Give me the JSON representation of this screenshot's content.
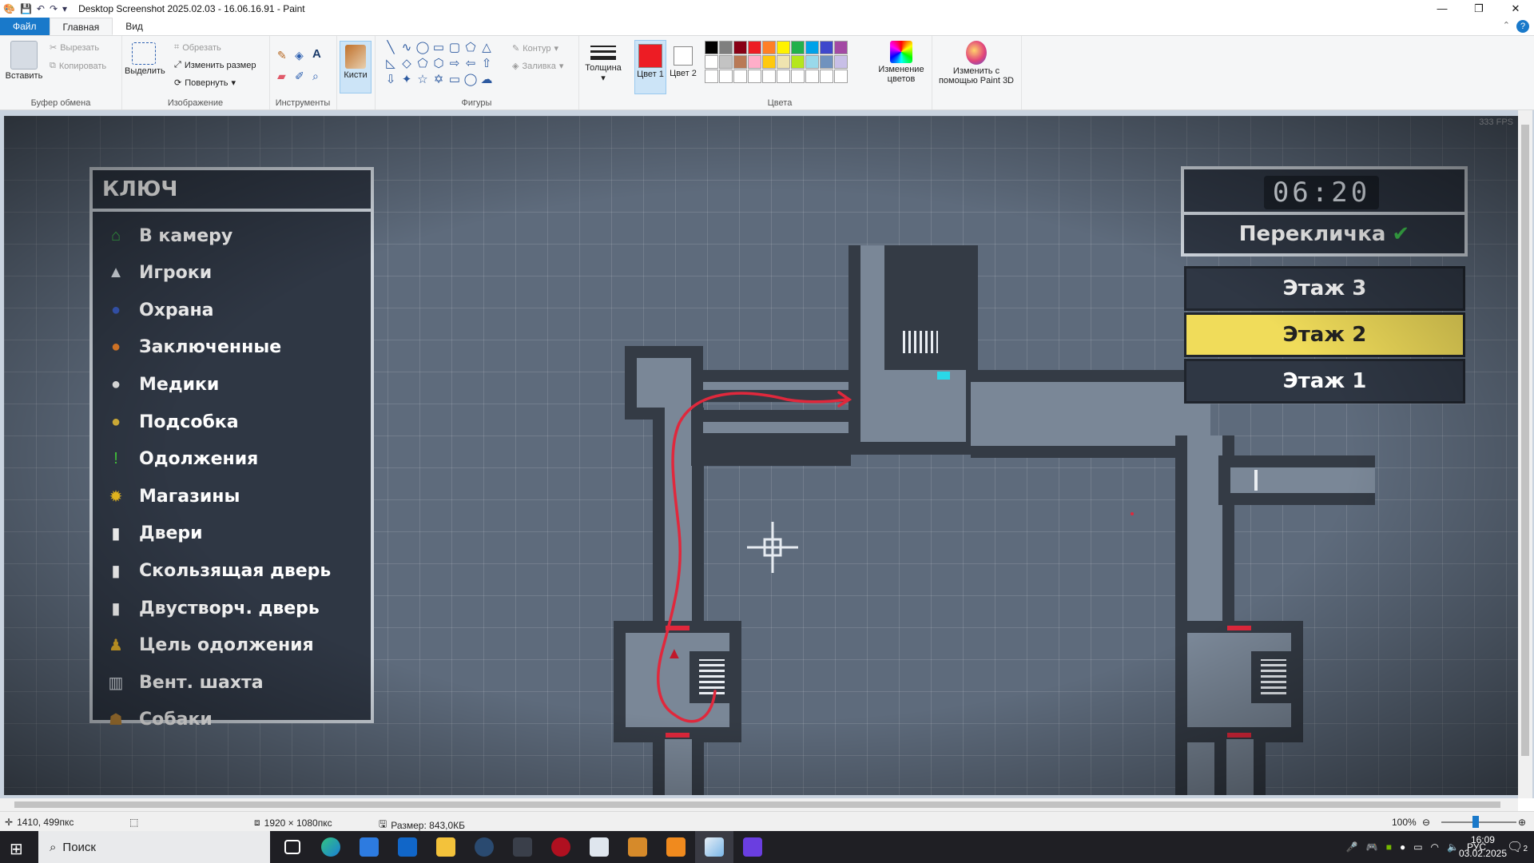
{
  "window": {
    "title": "Desktop Screenshot 2025.02.03 - 16.06.16.91 - Paint",
    "controls": [
      "—",
      "❐",
      "✕"
    ]
  },
  "ribbon_tabs": {
    "file": "Файл",
    "home": "Главная",
    "view": "Вид",
    "help": "?"
  },
  "ribbon": {
    "clipboard": {
      "paste": "Вставить",
      "cut": "Вырезать",
      "copy": "Копировать",
      "label": "Буфер обмена"
    },
    "image": {
      "select": "Выделить",
      "crop": "Обрезать",
      "resize": "Изменить размер",
      "rotate": "Повернуть",
      "label": "Изображение"
    },
    "tools": {
      "label": "Инструменты"
    },
    "brushes": {
      "label": "Кисти"
    },
    "shapes": {
      "outline": "Контур",
      "fill": "Заливка",
      "label": "Фигуры"
    },
    "size": {
      "label": "Толщина"
    },
    "colors": {
      "color1": "Цвет 1",
      "color2": "Цвет 2",
      "edit": "Изменение цветов",
      "paint3d": "Изменить с помощью Paint 3D",
      "label": "Цвета",
      "color1_value": "#ed1c24",
      "color2_value": "#ffffff",
      "palette_row1": [
        "#000000",
        "#7f7f7f",
        "#880015",
        "#ed1c24",
        "#ff7f27",
        "#fff200",
        "#22b14c",
        "#00a2e8",
        "#3f48cc",
        "#a349a4"
      ],
      "palette_row2": [
        "#ffffff",
        "#c3c3c3",
        "#b97a57",
        "#ffaec9",
        "#ffc90e",
        "#efe4b0",
        "#b5e61d",
        "#99d9ea",
        "#7092be",
        "#c8bfe7"
      ]
    }
  },
  "game": {
    "fps": "333 FPS",
    "legend": {
      "title": "КЛЮЧ",
      "items": [
        {
          "icon": "house-icon",
          "label": "В камеру",
          "color": "#3cb84a"
        },
        {
          "icon": "player-icon",
          "label": "Игроки",
          "color": "#dfe5ec"
        },
        {
          "icon": "guard-icon",
          "label": "Охрана",
          "color": "#3a5cc0"
        },
        {
          "icon": "prisoner-icon",
          "label": "Заключенные",
          "color": "#e8802a"
        },
        {
          "icon": "medic-icon",
          "label": "Медики",
          "color": "#e8e8e8"
        },
        {
          "icon": "janitor-icon",
          "label": "Подсобка",
          "color": "#d9b43a"
        },
        {
          "icon": "favor-icon",
          "label": "Одолжения",
          "color": "#46d13c"
        },
        {
          "icon": "shop-icon",
          "label": "Магазины",
          "color": "#f0c020"
        },
        {
          "icon": "door-icon",
          "label": "Двери",
          "color": "#ffffff"
        },
        {
          "icon": "sliding-door-icon",
          "label": "Скользящая дверь",
          "color": "#ffffff"
        },
        {
          "icon": "double-door-icon",
          "label": "Двустворч. дверь",
          "color": "#ffffff"
        },
        {
          "icon": "favor-target-icon",
          "label": "Цель одолжения",
          "color": "#e3b02a"
        },
        {
          "icon": "vent-icon",
          "label": "Вент. шахта",
          "color": "#dfe5ec"
        },
        {
          "icon": "dog-icon",
          "label": "Собаки",
          "color": "#c08a3a"
        }
      ]
    },
    "clock": "06:20",
    "routine": "Перекличка",
    "floors": [
      {
        "label": "Этаж 3",
        "active": false
      },
      {
        "label": "Этаж 2",
        "active": true
      },
      {
        "label": "Этаж 1",
        "active": false
      }
    ]
  },
  "statusbar": {
    "cursor": "1410, 499пкс",
    "dimensions": "1920 × 1080пкс",
    "filesize": "Размер: 843,0КБ",
    "zoom": "100%"
  },
  "taskbar": {
    "search": "Поиск",
    "language": "РУС",
    "time": "16:09",
    "date": "03.02.2025",
    "notifications": "2"
  }
}
